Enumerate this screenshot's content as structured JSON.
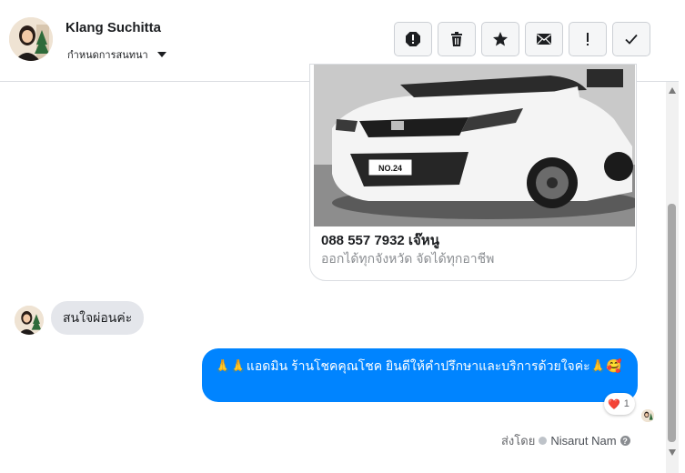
{
  "header": {
    "contact_name": "Klang Suchitta",
    "assign_label": "กำหนดการสนทนา",
    "toolbar": [
      {
        "name": "report-spam-icon",
        "label": ""
      },
      {
        "name": "trash-icon",
        "label": ""
      },
      {
        "name": "star-icon",
        "label": ""
      },
      {
        "name": "mail-icon",
        "label": ""
      },
      {
        "name": "follow-up-icon",
        "label": "!"
      },
      {
        "name": "done-check-icon",
        "label": ""
      }
    ]
  },
  "messages": {
    "card": {
      "title": "088 557 7932 เจ๊หนู",
      "subtitle": "ออกได้ทุกจังหวัด จัดได้ทุกอาชีพ",
      "plate": "NO.24"
    },
    "incoming": {
      "text": "สนใจผ่อนค่ะ"
    },
    "outgoing": {
      "text": "🙏🙏แอดมิน ร้านโชคคุณโชค ยินดีให้คำปรึกษาและบริการด้วยใจค่ะ🙏🥰",
      "reaction_emoji": "❤️",
      "reaction_count": "1"
    },
    "sent_by": {
      "prefix": "ส่งโดย",
      "name": "Nisarut Nam"
    }
  },
  "colors": {
    "outgoing_bubble": "#0084ff",
    "incoming_bubble": "#e4e6eb",
    "border": "#dadde1"
  }
}
